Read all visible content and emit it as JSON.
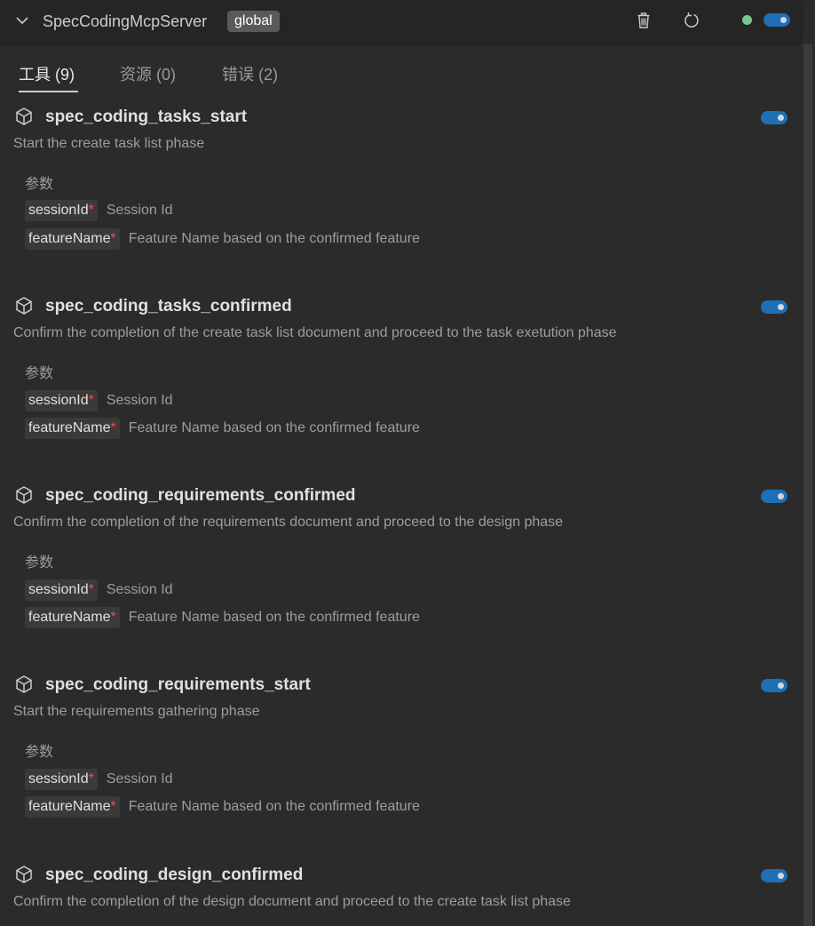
{
  "header": {
    "server_name": "SpecCodingMcpServer",
    "badge": "global",
    "status_color": "#73c991",
    "enabled": true
  },
  "tabs": [
    {
      "label": "工具 (9)",
      "active": true
    },
    {
      "label": "资源 (0)",
      "active": false
    },
    {
      "label": "错误 (2)",
      "active": false
    }
  ],
  "tools": [
    {
      "name": "spec_coding_tasks_start",
      "description": "Start the create task list phase",
      "params_label": "参数",
      "params": [
        {
          "name": "sessionId",
          "required_mark": "*",
          "description": "Session Id"
        },
        {
          "name": "featureName",
          "required_mark": "*",
          "description": "Feature Name based on the confirmed feature"
        }
      ],
      "enabled": true
    },
    {
      "name": "spec_coding_tasks_confirmed",
      "description": "Confirm the completion of the create task list document and proceed to the task exetution phase",
      "params_label": "参数",
      "params": [
        {
          "name": "sessionId",
          "required_mark": "*",
          "description": "Session Id"
        },
        {
          "name": "featureName",
          "required_mark": "*",
          "description": "Feature Name based on the confirmed feature"
        }
      ],
      "enabled": true
    },
    {
      "name": "spec_coding_requirements_confirmed",
      "description": "Confirm the completion of the requirements document and proceed to the design phase",
      "params_label": "参数",
      "params": [
        {
          "name": "sessionId",
          "required_mark": "*",
          "description": "Session Id"
        },
        {
          "name": "featureName",
          "required_mark": "*",
          "description": "Feature Name based on the confirmed feature"
        }
      ],
      "enabled": true
    },
    {
      "name": "spec_coding_requirements_start",
      "description": "Start the requirements gathering phase",
      "params_label": "参数",
      "params": [
        {
          "name": "sessionId",
          "required_mark": "*",
          "description": "Session Id"
        },
        {
          "name": "featureName",
          "required_mark": "*",
          "description": "Feature Name based on the confirmed feature"
        }
      ],
      "enabled": true
    },
    {
      "name": "spec_coding_design_confirmed",
      "description": "Confirm the completion of the design document and proceed to the create task list phase",
      "enabled": true
    }
  ],
  "icons": {
    "expand": "chevron-down-icon",
    "delete": "trash-icon",
    "refresh": "refresh-icon",
    "tool": "cube-icon"
  },
  "colors": {
    "accent": "#1f6fb5",
    "required": "#f14c4c"
  }
}
